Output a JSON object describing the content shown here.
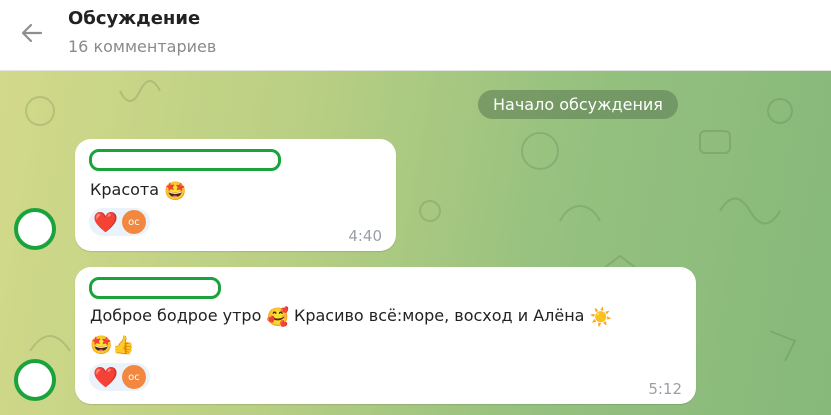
{
  "header": {
    "title": "Обсуждение",
    "subtitle": "16 комментариев",
    "back_icon": "arrow-left-icon"
  },
  "chat": {
    "start_pill": "Начало обсуждения",
    "messages": [
      {
        "text": "Красота",
        "emoji_after": "🤩",
        "reactions": [
          "❤️",
          "ос"
        ],
        "time": "4:40"
      },
      {
        "text_part1": "Доброе бодрое утро",
        "emoji1": "🥰",
        "text_part2": "Красиво всё:море, восход и Алёна",
        "emoji2": "☀️",
        "line2_emojis": "🤩👍",
        "reactions": [
          "❤️",
          "ос"
        ],
        "time": "5:12"
      }
    ]
  },
  "colors": {
    "accent_green": "#1aa33d",
    "reaction_avatar": "#f2883f"
  }
}
